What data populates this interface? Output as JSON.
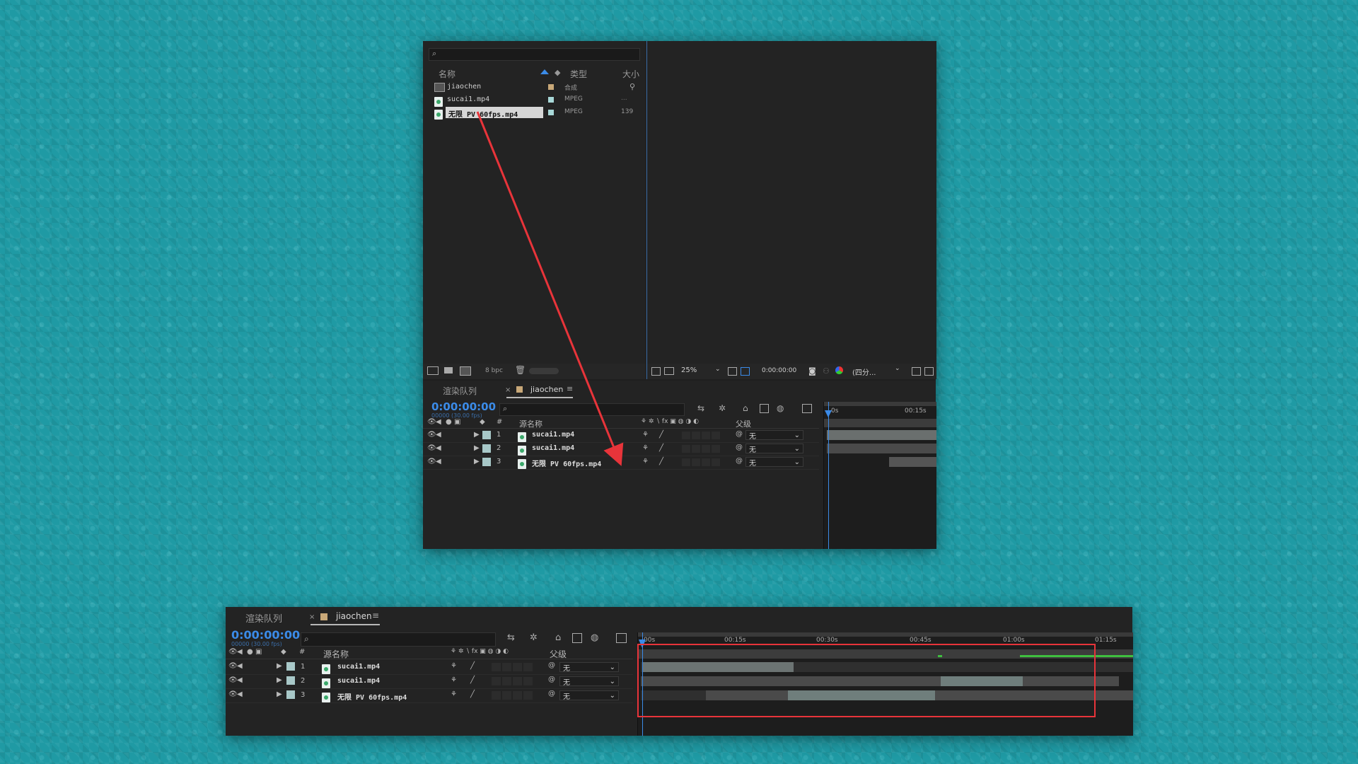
{
  "project": {
    "search_placeholder": "",
    "columns": {
      "name": "名称",
      "type": "类型",
      "size": "大小"
    },
    "items": [
      {
        "name": "jiaochen",
        "type": "合成",
        "size": "",
        "icon": "composition-icon",
        "label_color": "#c8a878"
      },
      {
        "name": "sucai1.mp4",
        "type": "MPEG",
        "size": "...",
        "icon": "video-file-icon",
        "label_color": "#a8d8d8"
      },
      {
        "name": "无限 PV 60fps.mp4",
        "type": "MPEG",
        "size": "139",
        "icon": "video-file-icon",
        "label_color": "#a8d8d8",
        "selected": true
      }
    ],
    "bpc": "8 bpc"
  },
  "viewer": {
    "zoom": "25%",
    "timecode": "0:00:00:00",
    "resolution": "(四分..."
  },
  "timeline_top": {
    "tab_render": "渲染队列",
    "tab_comp": "jiaochen",
    "timecode": "0:00:00:00",
    "frame_info": "00000 (30.00 fps)",
    "col_source": "源名称",
    "col_num": "#",
    "col_parent": "父级",
    "ruler": [
      "0s",
      "00:15s"
    ],
    "layers": [
      {
        "num": "1",
        "name": "sucai1.mp4",
        "parent": "无"
      },
      {
        "num": "2",
        "name": "sucai1.mp4",
        "parent": "无"
      },
      {
        "num": "3",
        "name": "无限 PV 60fps.mp4",
        "parent": "无"
      }
    ]
  },
  "timeline_bottom": {
    "tab_render": "渲染队列",
    "tab_comp": "jiaochen",
    "timecode": "0:00:00:00",
    "frame_info": "00000 (30.00 fps)",
    "col_source": "源名称",
    "col_num": "#",
    "col_parent": "父级",
    "ruler": [
      "00s",
      "00:15s",
      "00:30s",
      "00:45s",
      "01:00s",
      "01:15s"
    ],
    "layers": [
      {
        "num": "1",
        "name": "sucai1.mp4",
        "parent": "无"
      },
      {
        "num": "2",
        "name": "sucai1.mp4",
        "parent": "无"
      },
      {
        "num": "3",
        "name": "无限 PV 60fps.mp4",
        "parent": "无"
      }
    ]
  },
  "annotations": {
    "arrow_color": "#e8343a",
    "box_color": "#e8343a"
  }
}
